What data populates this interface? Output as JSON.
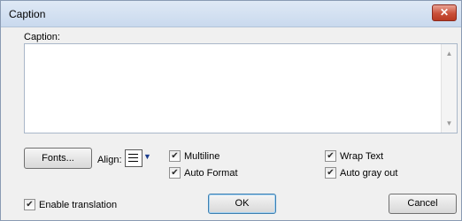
{
  "window": {
    "title": "Caption",
    "close_glyph": "✕"
  },
  "caption": {
    "label": "Caption:",
    "value": ""
  },
  "textarea_scroll": {
    "up": "▲",
    "down": "▼"
  },
  "buttons": {
    "fonts": "Fonts...",
    "ok": "OK",
    "cancel": "Cancel"
  },
  "align": {
    "label": "Align:",
    "icon": "align-left-icon",
    "arrow": "▼"
  },
  "checkboxes": {
    "multiline": {
      "label": "Multiline",
      "checked": true
    },
    "auto_format": {
      "label": "Auto Format",
      "checked": true
    },
    "wrap_text": {
      "label": "Wrap Text",
      "checked": true
    },
    "auto_gray_out": {
      "label": "Auto gray out",
      "checked": true
    },
    "enable_translation": {
      "label": "Enable translation",
      "checked": true
    }
  },
  "check_glyph": "✔",
  "colors": {
    "title_bar": "#c9d9ee",
    "close_button": "#c9503a",
    "dialog_bg": "#f0f0f0"
  }
}
